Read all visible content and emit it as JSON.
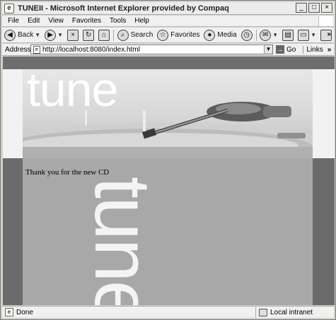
{
  "window": {
    "title": "TUNEII - Microsoft Internet Explorer provided by Compaq",
    "controls": [
      "_",
      "□",
      "×"
    ]
  },
  "menu": [
    "File",
    "Edit",
    "View",
    "Favorites",
    "Tools",
    "Help"
  ],
  "toolbar": {
    "back": "Back",
    "search": "Search",
    "favorites": "Favorites",
    "media": "Media",
    "more": "»"
  },
  "address": {
    "label": "Address",
    "url": "http://localhost:8080/index.html",
    "go": "Go",
    "links": "Links",
    "more": "»"
  },
  "page": {
    "banner_logo": "tune",
    "message": "Thank you for the new CD",
    "vertical_logo": "tune"
  },
  "status": {
    "text": "Done",
    "zone": "Local intranet"
  }
}
